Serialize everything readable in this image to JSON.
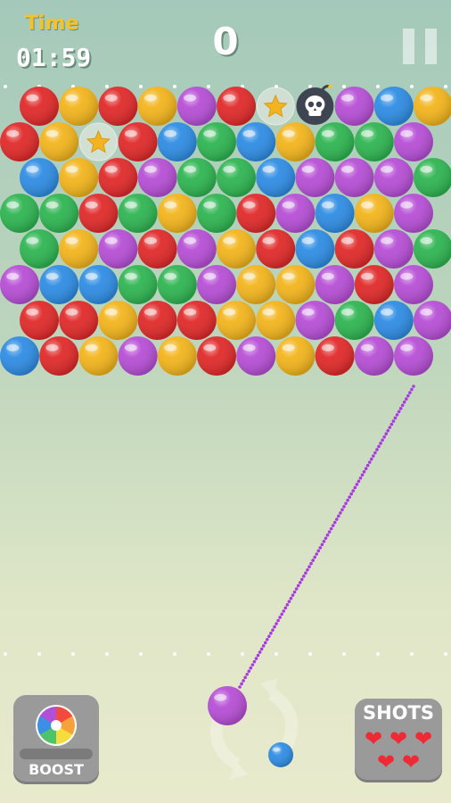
{
  "hud": {
    "time_label": "Time",
    "time_value": "01:59",
    "score": "0"
  },
  "colors": {
    "red": "#e12a2a",
    "orange": "#f3b51d",
    "purple": "#b74fd6",
    "blue": "#2f8de4",
    "green": "#2fb552",
    "time_label": "#f6c326",
    "aim_line": "#a83ae0",
    "heart": "#ef2a35"
  },
  "board": {
    "rows": [
      [
        "red",
        "orange",
        "red",
        "orange",
        "purple",
        "red",
        "star",
        "bomb",
        "purple",
        "blue",
        "orange"
      ],
      [
        "red",
        "orange",
        "star",
        "red",
        "blue",
        "green",
        "blue",
        "orange",
        "green",
        "green",
        "purple"
      ],
      [
        "blue",
        "orange",
        "red",
        "purple",
        "green",
        "green",
        "blue",
        "purple",
        "purple",
        "purple",
        "green"
      ],
      [
        "green",
        "green",
        "red",
        "green",
        "orange",
        "green",
        "red",
        "purple",
        "blue",
        "orange",
        "purple"
      ],
      [
        "green",
        "orange",
        "purple",
        "red",
        "purple",
        "orange",
        "red",
        "blue",
        "red",
        "purple",
        "green"
      ],
      [
        "purple",
        "blue",
        "blue",
        "green",
        "green",
        "purple",
        "orange",
        "orange",
        "purple",
        "red",
        "purple"
      ],
      [
        "red",
        "red",
        "orange",
        "red",
        "red",
        "orange",
        "orange",
        "purple",
        "green",
        "blue",
        "purple"
      ],
      [
        "blue",
        "red",
        "orange",
        "purple",
        "orange",
        "red",
        "purple",
        "orange",
        "red",
        "purple",
        "purple"
      ]
    ]
  },
  "shooter": {
    "current_bubble": "purple",
    "next_bubble": "blue",
    "swap_icon": "swap-arrows-icon"
  },
  "boost": {
    "label": "BOOST",
    "icon": "rainbow-wheel-icon",
    "charge": 0
  },
  "shots": {
    "label": "SHOTS",
    "remaining": 5,
    "icon": "heart-icon"
  }
}
